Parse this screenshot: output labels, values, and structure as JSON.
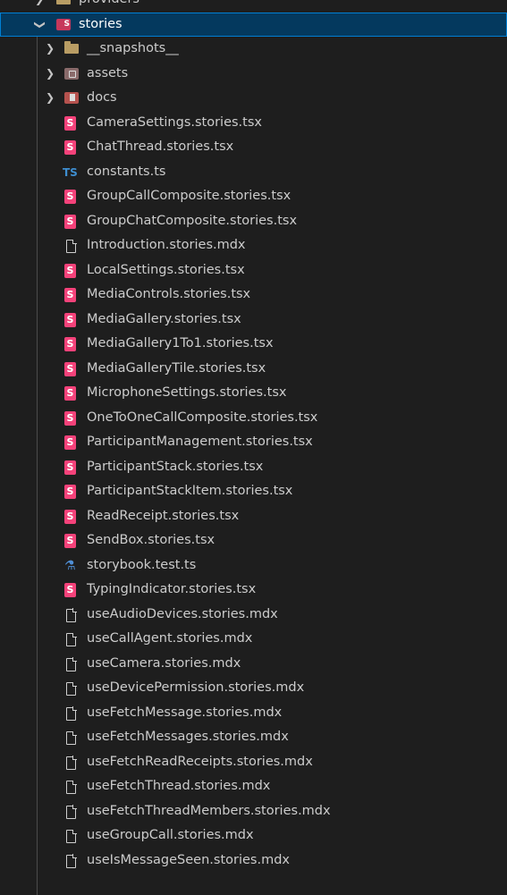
{
  "explorer": {
    "parent_folder": {
      "label": "providers"
    },
    "stories_folder": {
      "label": "stories"
    },
    "subfolders": [
      {
        "label": "__snapshots__",
        "icon": "folder-icon"
      },
      {
        "label": "assets",
        "icon": "assets-folder-icon"
      },
      {
        "label": "docs",
        "icon": "docs-folder-icon"
      }
    ],
    "files": [
      {
        "label": "CameraSettings.stories.tsx",
        "icon": "storybook-icon"
      },
      {
        "label": "ChatThread.stories.tsx",
        "icon": "storybook-icon"
      },
      {
        "label": "constants.ts",
        "icon": "typescript-icon"
      },
      {
        "label": "GroupCallComposite.stories.tsx",
        "icon": "storybook-icon"
      },
      {
        "label": "GroupChatComposite.stories.tsx",
        "icon": "storybook-icon"
      },
      {
        "label": "Introduction.stories.mdx",
        "icon": "document-icon"
      },
      {
        "label": "LocalSettings.stories.tsx",
        "icon": "storybook-icon"
      },
      {
        "label": "MediaControls.stories.tsx",
        "icon": "storybook-icon"
      },
      {
        "label": "MediaGallery.stories.tsx",
        "icon": "storybook-icon"
      },
      {
        "label": "MediaGallery1To1.stories.tsx",
        "icon": "storybook-icon"
      },
      {
        "label": "MediaGalleryTile.stories.tsx",
        "icon": "storybook-icon"
      },
      {
        "label": "MicrophoneSettings.stories.tsx",
        "icon": "storybook-icon"
      },
      {
        "label": "OneToOneCallComposite.stories.tsx",
        "icon": "storybook-icon"
      },
      {
        "label": "ParticipantManagement.stories.tsx",
        "icon": "storybook-icon"
      },
      {
        "label": "ParticipantStack.stories.tsx",
        "icon": "storybook-icon"
      },
      {
        "label": "ParticipantStackItem.stories.tsx",
        "icon": "storybook-icon"
      },
      {
        "label": "ReadReceipt.stories.tsx",
        "icon": "storybook-icon"
      },
      {
        "label": "SendBox.stories.tsx",
        "icon": "storybook-icon"
      },
      {
        "label": "storybook.test.ts",
        "icon": "test-flask-icon"
      },
      {
        "label": "TypingIndicator.stories.tsx",
        "icon": "storybook-icon"
      },
      {
        "label": "useAudioDevices.stories.mdx",
        "icon": "document-icon"
      },
      {
        "label": "useCallAgent.stories.mdx",
        "icon": "document-icon"
      },
      {
        "label": "useCamera.stories.mdx",
        "icon": "document-icon"
      },
      {
        "label": "useDevicePermission.stories.mdx",
        "icon": "document-icon"
      },
      {
        "label": "useFetchMessage.stories.mdx",
        "icon": "document-icon"
      },
      {
        "label": "useFetchMessages.stories.mdx",
        "icon": "document-icon"
      },
      {
        "label": "useFetchReadReceipts.stories.mdx",
        "icon": "document-icon"
      },
      {
        "label": "useFetchThread.stories.mdx",
        "icon": "document-icon"
      },
      {
        "label": "useFetchThreadMembers.stories.mdx",
        "icon": "document-icon"
      },
      {
        "label": "useGroupCall.stories.mdx",
        "icon": "document-icon"
      },
      {
        "label": "useIsMessageSeen.stories.mdx",
        "icon": "document-icon"
      }
    ]
  },
  "colors": {
    "background": "#1e1e1e",
    "selected_row": "#04395e",
    "focus_border": "#007fd4",
    "storybook": "#f4427a",
    "typescript": "#3e8ed0",
    "folder": "#b99d64"
  }
}
